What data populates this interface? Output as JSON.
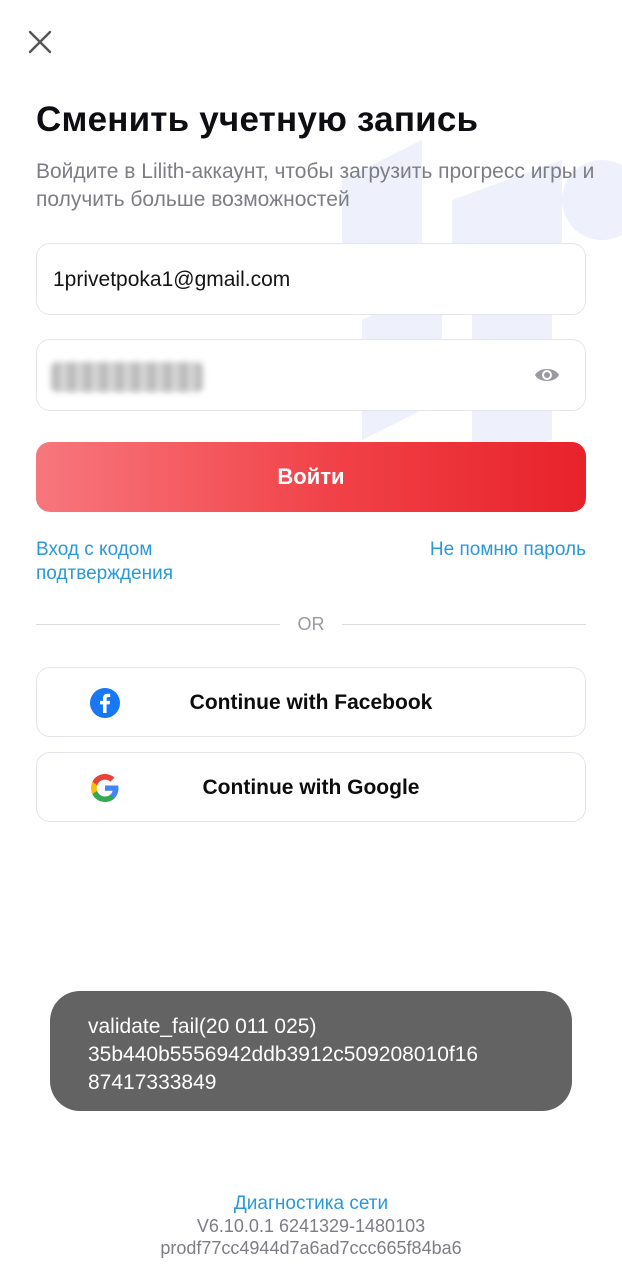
{
  "header": {
    "title": "Сменить учетную запись",
    "subtitle": "Войдите в Lilith-аккаунт, чтобы загрузить прогресс игры и получить больше возможностей"
  },
  "form": {
    "email_value": "1privetpoka1@gmail.com",
    "login_button": "Войти",
    "code_login_link": "Вход с кодом подтверждения",
    "forgot_password_link": "Не помню пароль",
    "divider_text": "OR"
  },
  "social": {
    "facebook_label": "Continue with Facebook",
    "google_label": "Continue with Google"
  },
  "toast": {
    "line1": "validate_fail(20 011 025)",
    "line2": "35b440b5556942ddb3912c509208010f16",
    "line3": "87417333849"
  },
  "footer": {
    "diagnostics_link": "Диагностика сети",
    "version": "V6.10.0.1 6241329-1480103",
    "build": "prodf77cc4944d7a6ad7ccc665f84ba6"
  },
  "colors": {
    "accent_link": "#2a99d8",
    "login_button_start": "#f7777d",
    "login_button_end": "#e8222a",
    "toast_bg": "#636363"
  },
  "icons": [
    "close-icon",
    "eye-icon",
    "facebook-icon",
    "google-icon"
  ]
}
